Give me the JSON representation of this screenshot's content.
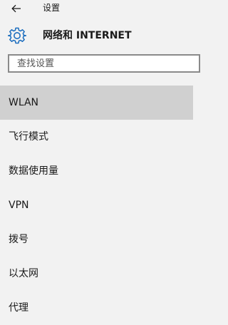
{
  "window": {
    "title": "设置",
    "back_icon": "arrow-left-icon"
  },
  "header": {
    "icon": "gear-icon",
    "title": "网络和 INTERNET",
    "accent_color": "#1e6fbf"
  },
  "search": {
    "placeholder": "查找设置",
    "value": ""
  },
  "nav": {
    "items": [
      {
        "label": "WLAN",
        "selected": true
      },
      {
        "label": "飞行模式",
        "selected": false
      },
      {
        "label": "数据使用量",
        "selected": false
      },
      {
        "label": "VPN",
        "selected": false
      },
      {
        "label": "拨号",
        "selected": false
      },
      {
        "label": "以太网",
        "selected": false
      },
      {
        "label": "代理",
        "selected": false
      }
    ]
  }
}
